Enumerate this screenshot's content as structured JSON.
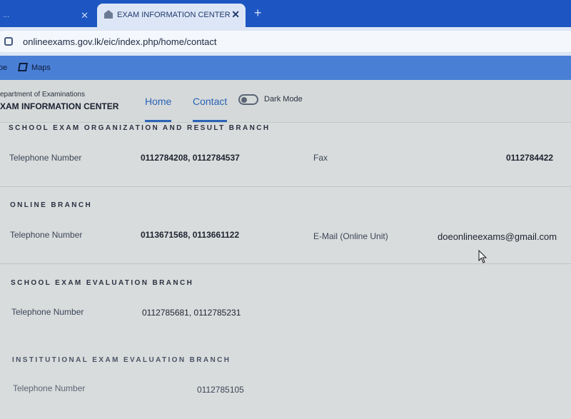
{
  "browser": {
    "tab_inactive_title": "...",
    "tab_active_title": "EXAM INFORMATION CENTER",
    "tab_close_symbol": "✕",
    "new_tab_symbol": "+",
    "url": "onlineexams.gov.lk/eic/index.php/home/contact",
    "bookmarks": [
      {
        "label": "be"
      },
      {
        "label": "Maps"
      }
    ]
  },
  "site": {
    "department": "epartment of Examinations",
    "center": "XAM INFORMATION CENTER",
    "nav": [
      {
        "label": "Home"
      },
      {
        "label": "Contact"
      }
    ],
    "dark_mode_label": "Dark Mode"
  },
  "sections": [
    {
      "title": "SCHOOL EXAM ORGANIZATION AND RESULT BRANCH",
      "telephone_label": "Telephone Number",
      "telephone_value": "0112784208, 0112784537",
      "secondary_label": "Fax",
      "secondary_value": "0112784422"
    },
    {
      "title": "ONLINE BRANCH",
      "telephone_label": "Telephone Number",
      "telephone_value": "0113671568, 0113661122",
      "secondary_label": "E-Mail (Online Unit)",
      "secondary_value": "doeonlineexams@gmail.com"
    },
    {
      "title": "SCHOOL EXAM EVALUATION BRANCH",
      "telephone_label": "Telephone Number",
      "telephone_value": "0112785681, 0112785231"
    },
    {
      "title": "INSTITUTIONAL EXAM EVALUATION BRANCH",
      "telephone_label": "Telephone Number",
      "telephone_value": "0112785105"
    }
  ]
}
